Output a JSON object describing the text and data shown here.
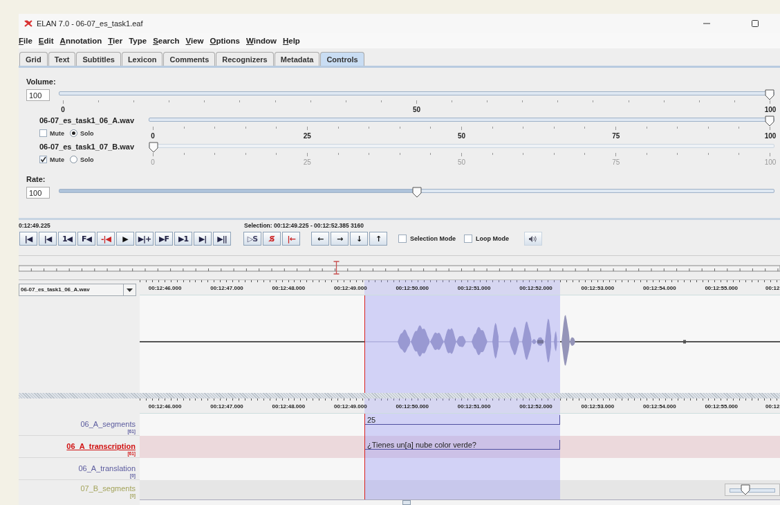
{
  "window": {
    "title": "ELAN 7.0 - 06-07_es_task1.eaf"
  },
  "menu": [
    {
      "label": "File",
      "mnemonic_underlined": true
    },
    {
      "label": "Edit",
      "mnemonic_underlined": true
    },
    {
      "label": "Annotation",
      "mnemonic_underlined": true
    },
    {
      "label": "Tier",
      "mnemonic_underlined": true
    },
    {
      "label": "Type",
      "mnemonic_underlined": false
    },
    {
      "label": "Search",
      "mnemonic_underlined": true
    },
    {
      "label": "View",
      "mnemonic_underlined": true
    },
    {
      "label": "Options",
      "mnemonic_underlined": true
    },
    {
      "label": "Window",
      "mnemonic_underlined": true
    },
    {
      "label": "Help",
      "mnemonic_underlined": true
    }
  ],
  "tabs": [
    {
      "label": "Grid",
      "selected": false
    },
    {
      "label": "Text",
      "selected": false
    },
    {
      "label": "Subtitles",
      "selected": false
    },
    {
      "label": "Lexicon",
      "selected": false
    },
    {
      "label": "Comments",
      "selected": false
    },
    {
      "label": "Recognizers",
      "selected": false
    },
    {
      "label": "Metadata",
      "selected": false
    },
    {
      "label": "Controls",
      "selected": true
    }
  ],
  "controls": {
    "volume": {
      "label": "Volume:",
      "value": "100",
      "level": 1,
      "scale": [
        "0",
        "50",
        "100"
      ]
    },
    "tracks": [
      {
        "name": "06-07_es_task1_06_A.wav",
        "level": 1,
        "muted": false,
        "solo": true,
        "mute_label": "Mute",
        "solo_label": "Solo",
        "scale": [
          "0",
          "25",
          "50",
          "75",
          "100"
        ]
      },
      {
        "name": "06-07_es_task1_07_B.wav",
        "level": 0,
        "muted": true,
        "solo": false,
        "mute_label": "Mute",
        "solo_label": "Solo",
        "scale": [
          "0",
          "25",
          "50",
          "75",
          "100"
        ]
      }
    ],
    "rate": {
      "label": "Rate:",
      "value": "100",
      "level": 0.5
    }
  },
  "transport": {
    "time": "0:12:49.225",
    "selection": "Selection: 00:12:49.225 - 00:12:52.385  3160",
    "button_groups": [
      [
        {
          "label": "|◀",
          "color": "#222244"
        },
        {
          "label": "|◀",
          "color": "#222244"
        },
        {
          "label": "1◀",
          "color": "#222244"
        },
        {
          "label": "F◀",
          "color": "#222244"
        },
        {
          "label": "-|◀",
          "color": "#cc2222"
        },
        {
          "label": "▶",
          "color": "#111111"
        },
        {
          "label": "▶|+",
          "color": "#222244"
        },
        {
          "label": "▶F",
          "color": "#222244"
        },
        {
          "label": "▶1",
          "color": "#222244"
        },
        {
          "label": "▶|",
          "color": "#222244"
        },
        {
          "label": "▶||",
          "color": "#222244"
        }
      ],
      [
        {
          "label": "▷S",
          "color": "#444466"
        },
        {
          "label": "S̸",
          "color": "#cc2222"
        },
        {
          "label": "|←",
          "color": "#cc2222"
        }
      ],
      [
        {
          "label": "←",
          "color": "#111111"
        },
        {
          "label": "→",
          "color": "#111111"
        },
        {
          "label": "↓",
          "color": "#111111"
        },
        {
          "label": "↑",
          "color": "#111111"
        }
      ]
    ],
    "modes": [
      {
        "label": "Selection Mode",
        "checked": false
      },
      {
        "label": "Loop Mode",
        "checked": false
      }
    ]
  },
  "waveform": {
    "media": "06-07_es_task1_06_A.wav",
    "ruler": [
      "00:12:46.000",
      "00:12:47.000",
      "00:12:48.000",
      "00:12:49.000",
      "00:12:50.000",
      "00:12:51.000",
      "00:12:52.000",
      "00:12:53.000",
      "00:12:54.000",
      "00:12:55.000",
      "00:12"
    ]
  },
  "timeline": {
    "ruler": [
      "00:12:46.000",
      "00:12:47.000",
      "00:12:48.000",
      "00:12:49.000",
      "00:12:50.000",
      "00:12:51.000",
      "00:12:52.000",
      "00:12:53.000",
      "00:12:54.000",
      "00:12:55.000",
      "00:12"
    ],
    "tiers": [
      {
        "name": "06_A_segments",
        "count": "[61]",
        "color": "#5b5b9e",
        "selected": false,
        "annotations": [
          "25"
        ]
      },
      {
        "name": "06_A_transcription",
        "count": "[61]",
        "color": "#d01010",
        "selected": true,
        "annotations": [
          "¿Tienes un[a] nube color verde?"
        ]
      },
      {
        "name": "06_A_translation",
        "count": "[0]",
        "color": "#5b5b9e",
        "selected": false
      },
      {
        "name": "07_B_segments",
        "count": "[0]",
        "color": "#a3a35a",
        "selected": false
      }
    ],
    "zoom": {
      "level": 0.3
    }
  }
}
